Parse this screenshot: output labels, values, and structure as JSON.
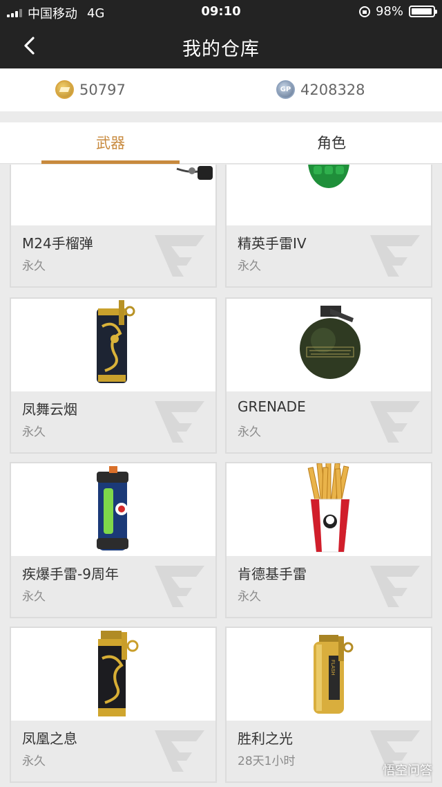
{
  "status_bar": {
    "carrier": "中国移动",
    "network": "4G",
    "time": "09:10",
    "battery": "98%",
    "battery_level": 0.98
  },
  "nav": {
    "title": "我的仓库",
    "back_icon": "chevron-left-icon"
  },
  "currency": {
    "cf_points": "50797",
    "gp_points": "4208328",
    "gp_icon_text": "GP"
  },
  "tabs": [
    {
      "label": "武器",
      "active": true
    },
    {
      "label": "角色",
      "active": false
    }
  ],
  "items": [
    {
      "name": "M24手榴弹",
      "duration": "永久",
      "icon": "stick-grenade-icon"
    },
    {
      "name": "精英手雷IV",
      "duration": "永久",
      "icon": "green-frag-grenade-icon"
    },
    {
      "name": "凤舞云烟",
      "duration": "永久",
      "icon": "dragon-smoke-grenade-icon"
    },
    {
      "name": "GRENADE",
      "duration": "永久",
      "icon": "round-grenade-icon"
    },
    {
      "name": "疾爆手雷-9周年",
      "duration": "永久",
      "icon": "anniversary-grenade-icon"
    },
    {
      "name": "肯德基手雷",
      "duration": "永久",
      "icon": "fries-grenade-icon"
    },
    {
      "name": "凤凰之息",
      "duration": "永久",
      "icon": "phoenix-grenade-icon"
    },
    {
      "name": "胜利之光",
      "duration": "28天1小时",
      "icon": "flashbang-icon"
    }
  ],
  "footer_watermark": "悟空问答",
  "colors": {
    "accent": "#c88a3e",
    "header_bg": "#232323",
    "card_info_bg": "#eaeaea"
  }
}
